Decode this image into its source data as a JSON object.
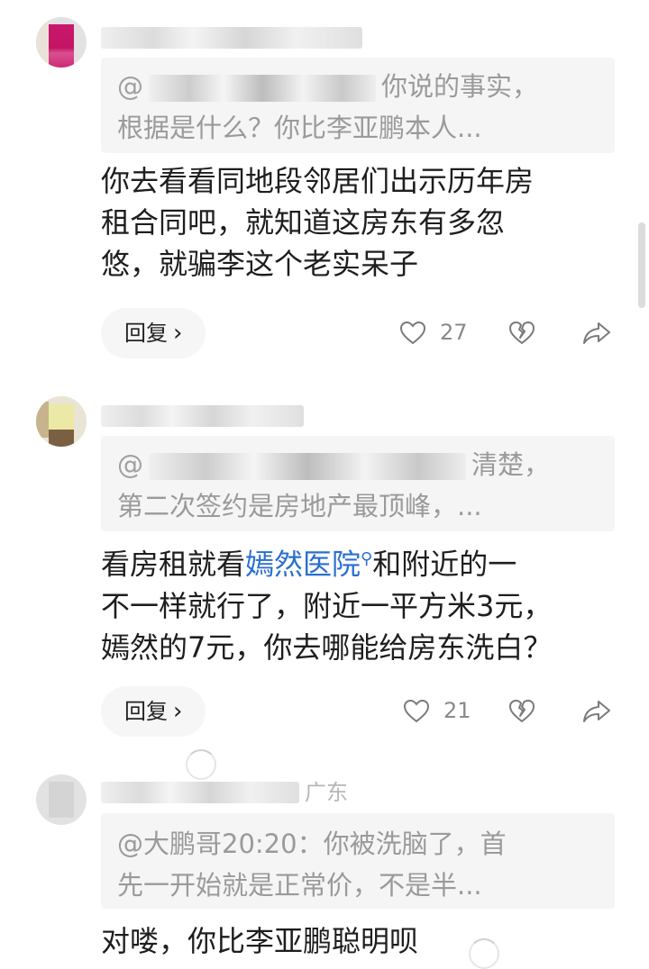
{
  "comments": [
    {
      "name_tail": "",
      "quote_prefix": "@",
      "quote_line1_tail": "你说的事实，",
      "quote_line2": "根据是什么？你比李亚鹏本人...",
      "body_lines": [
        "你去看看同地段邻居们出示历年房",
        "租合同吧，就知道这房东有多忽",
        "悠，就骗李这个老实呆子"
      ],
      "reply_label": "回复",
      "like_count": "27"
    },
    {
      "name_tail": "",
      "quote_prefix": "@",
      "quote_line1_tail": "清楚，",
      "quote_line2": "第二次签约是房地产最顶峰，...",
      "body_line1_pre": "看房租就看",
      "body_line1_link": "嫣然医院",
      "body_line1_post": "和附近的一",
      "body_lines_rest": [
        "不一样就行了，附近一平方米3元，",
        "嫣然的7元，你去哪能给房东洗白？"
      ],
      "reply_label": "回复",
      "like_count": "21"
    },
    {
      "name_tail": "广东",
      "quote_line1": "@大鹏哥20:20：你被洗脑了，首",
      "quote_line2": "先一开始就是正常价，不是半...",
      "body_lines": [
        "对喽，你比李亚鹏聪明呗"
      ]
    }
  ],
  "colors": {
    "mention": "#2a6fcf",
    "quote_bg": "#f5f5f5",
    "text": "#1e1e1e"
  },
  "icons": {
    "like": "heart-icon",
    "dislike": "broken-heart-icon",
    "share": "share-arrow-icon",
    "reply": "chevron-right-icon",
    "search": "search-icon"
  }
}
